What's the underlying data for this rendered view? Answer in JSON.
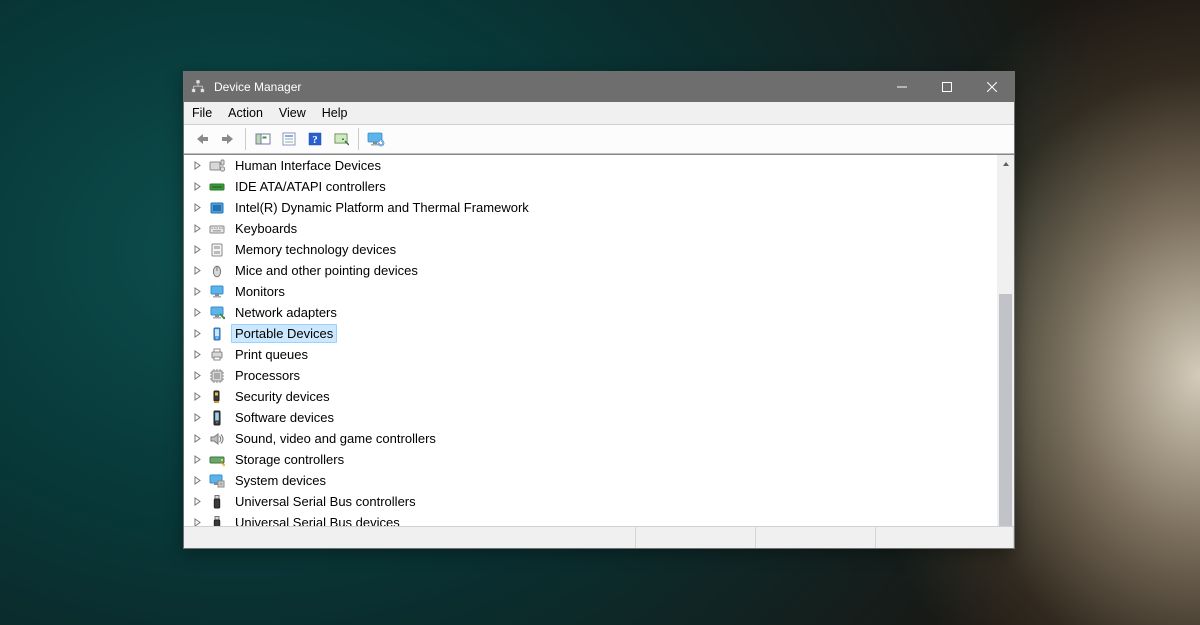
{
  "window": {
    "title": "Device Manager"
  },
  "menubar": {
    "items": [
      "File",
      "Action",
      "View",
      "Help"
    ]
  },
  "toolbar": {
    "buttons": [
      {
        "name": "back",
        "icon": "arrow-left"
      },
      {
        "name": "forward",
        "icon": "arrow-right"
      },
      {
        "name": "sep"
      },
      {
        "name": "show-hidden",
        "icon": "show-panel"
      },
      {
        "name": "properties",
        "icon": "properties"
      },
      {
        "name": "help",
        "icon": "help"
      },
      {
        "name": "scan",
        "icon": "scan"
      },
      {
        "name": "sep"
      },
      {
        "name": "monitor-toggle",
        "icon": "monitor-glyph"
      }
    ]
  },
  "tree": {
    "items": [
      {
        "label": "Human Interface Devices",
        "icon": "hid",
        "selected": false
      },
      {
        "label": "IDE ATA/ATAPI controllers",
        "icon": "ide",
        "selected": false
      },
      {
        "label": "Intel(R) Dynamic Platform and Thermal Framework",
        "icon": "intel",
        "selected": false
      },
      {
        "label": "Keyboards",
        "icon": "keyboard",
        "selected": false
      },
      {
        "label": "Memory technology devices",
        "icon": "memory",
        "selected": false
      },
      {
        "label": "Mice and other pointing devices",
        "icon": "mouse",
        "selected": false
      },
      {
        "label": "Monitors",
        "icon": "monitor",
        "selected": false
      },
      {
        "label": "Network adapters",
        "icon": "network",
        "selected": false
      },
      {
        "label": "Portable Devices",
        "icon": "portable",
        "selected": true
      },
      {
        "label": "Print queues",
        "icon": "printer",
        "selected": false
      },
      {
        "label": "Processors",
        "icon": "cpu",
        "selected": false
      },
      {
        "label": "Security devices",
        "icon": "security",
        "selected": false
      },
      {
        "label": "Software devices",
        "icon": "software",
        "selected": false
      },
      {
        "label": "Sound, video and game controllers",
        "icon": "sound",
        "selected": false
      },
      {
        "label": "Storage controllers",
        "icon": "storage",
        "selected": false
      },
      {
        "label": "System devices",
        "icon": "system",
        "selected": false
      },
      {
        "label": "Universal Serial Bus controllers",
        "icon": "usb",
        "selected": false
      },
      {
        "label": "Universal Serial Bus devices",
        "icon": "usb",
        "selected": false
      }
    ]
  }
}
